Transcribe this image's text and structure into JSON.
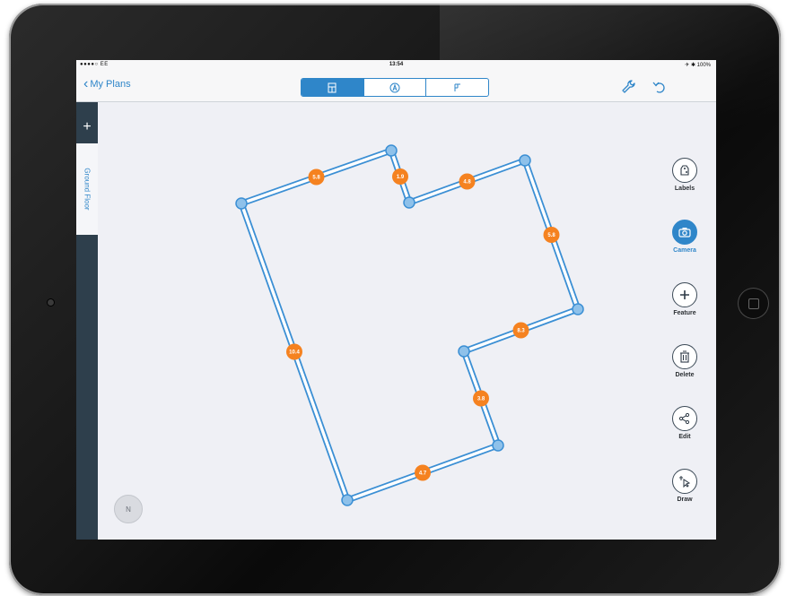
{
  "status_bar": {
    "carrier": "●●●●○ EE",
    "time": "13:54",
    "battery": "✈ ✱ 100%"
  },
  "nav": {
    "back_label": "My Plans",
    "segments": [
      {
        "icon": "floorplan-icon",
        "active": true
      },
      {
        "icon": "compass-a-icon",
        "active": false
      },
      {
        "icon": "layout-icon",
        "active": false
      }
    ],
    "right_icons": [
      "wrench-icon",
      "undo-icon"
    ]
  },
  "sidebar": {
    "add_label": "+",
    "floor_tab": "Ground Floor"
  },
  "toolbar": [
    {
      "label": "Labels",
      "icon": "label-tag-icon",
      "active": false
    },
    {
      "label": "Camera",
      "icon": "camera-icon",
      "active": true
    },
    {
      "label": "Feature",
      "icon": "plus-icon",
      "active": false
    },
    {
      "label": "Delete",
      "icon": "trash-icon",
      "active": false
    },
    {
      "label": "Edit",
      "icon": "share-nodes-icon",
      "active": false
    },
    {
      "label": "Draw",
      "icon": "pointer-icon",
      "active": false
    }
  ],
  "plan": {
    "wall_color": "#3b8fd4",
    "node_color": "#8ec1ea",
    "badge_color": "#f58220",
    "measurements": [
      "5.8",
      "1.9",
      "4.8",
      "5.8",
      "8.3",
      "10.4",
      "3.8",
      "4.7"
    ]
  },
  "compass_label": "N",
  "colors": {
    "accent": "#2f86c9",
    "sidebar": "#2e3f4c",
    "canvas_bg": "#eff0f5"
  }
}
